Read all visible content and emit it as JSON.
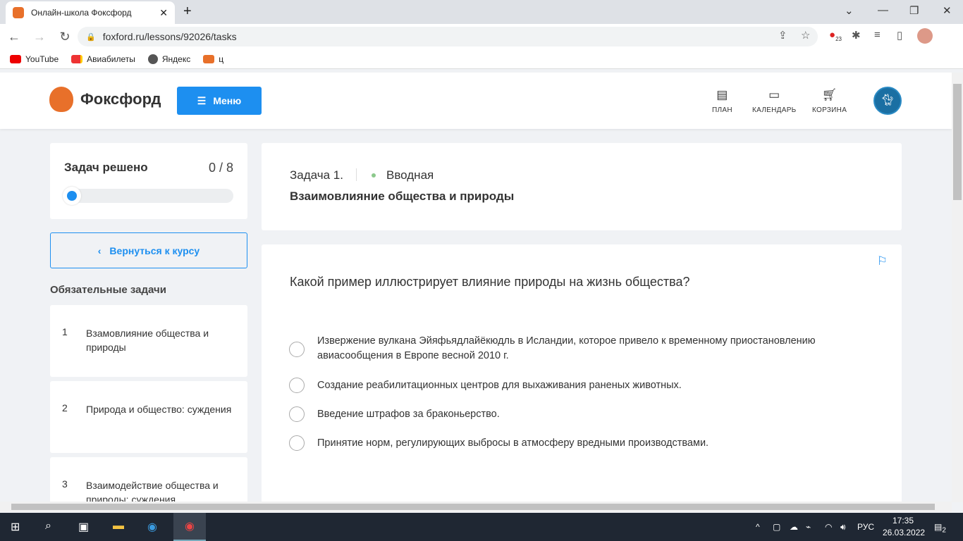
{
  "browser": {
    "tab_title": "Онлайн-школа Фоксфорд",
    "url": "foxford.ru/lessons/92026/tasks",
    "ext_badge": "23",
    "bookmarks": [
      "YouTube",
      "Авиабилеты",
      "Яндекс",
      "ц"
    ]
  },
  "header": {
    "logo": "Фоксфорд",
    "menu": "Меню",
    "nav": [
      "ПЛАН",
      "КАЛЕНДАРЬ",
      "КОРЗИНА"
    ]
  },
  "sidebar": {
    "progress_label": "Задач решено",
    "progress_count": "0 / 8",
    "progress_fraction": 0,
    "back": "Вернуться к курсу",
    "section": "Обязательные задачи",
    "tasks": [
      {
        "n": "1",
        "label": "Взамовлияние общества и природы"
      },
      {
        "n": "2",
        "label": "Природа и общество: суждения"
      },
      {
        "n": "3",
        "label": "Взаимодействие общества и природы: суждения"
      }
    ]
  },
  "task": {
    "number": "Задача 1.",
    "type": "Вводная",
    "title": "Взаимовлияние общества и природы",
    "question": "Какой пример иллюстрирует влияние природы на жизнь общества?",
    "options": [
      "Извержение вулкана Эйяфьядлайёкюдль в Исландии, которое привело к временному приостановлению авиасообщения в Европе весной 2010 г.",
      "Создание реабилитационных центров для выхаживания раненых животных.",
      "Введение штрафов за браконьерство.",
      "Принятие норм, регулирующих выбросы в атмосферу вредными производствами."
    ]
  },
  "taskbar": {
    "lang": "РУС",
    "time": "17:35",
    "date": "26.03.2022",
    "notifications": "2"
  }
}
